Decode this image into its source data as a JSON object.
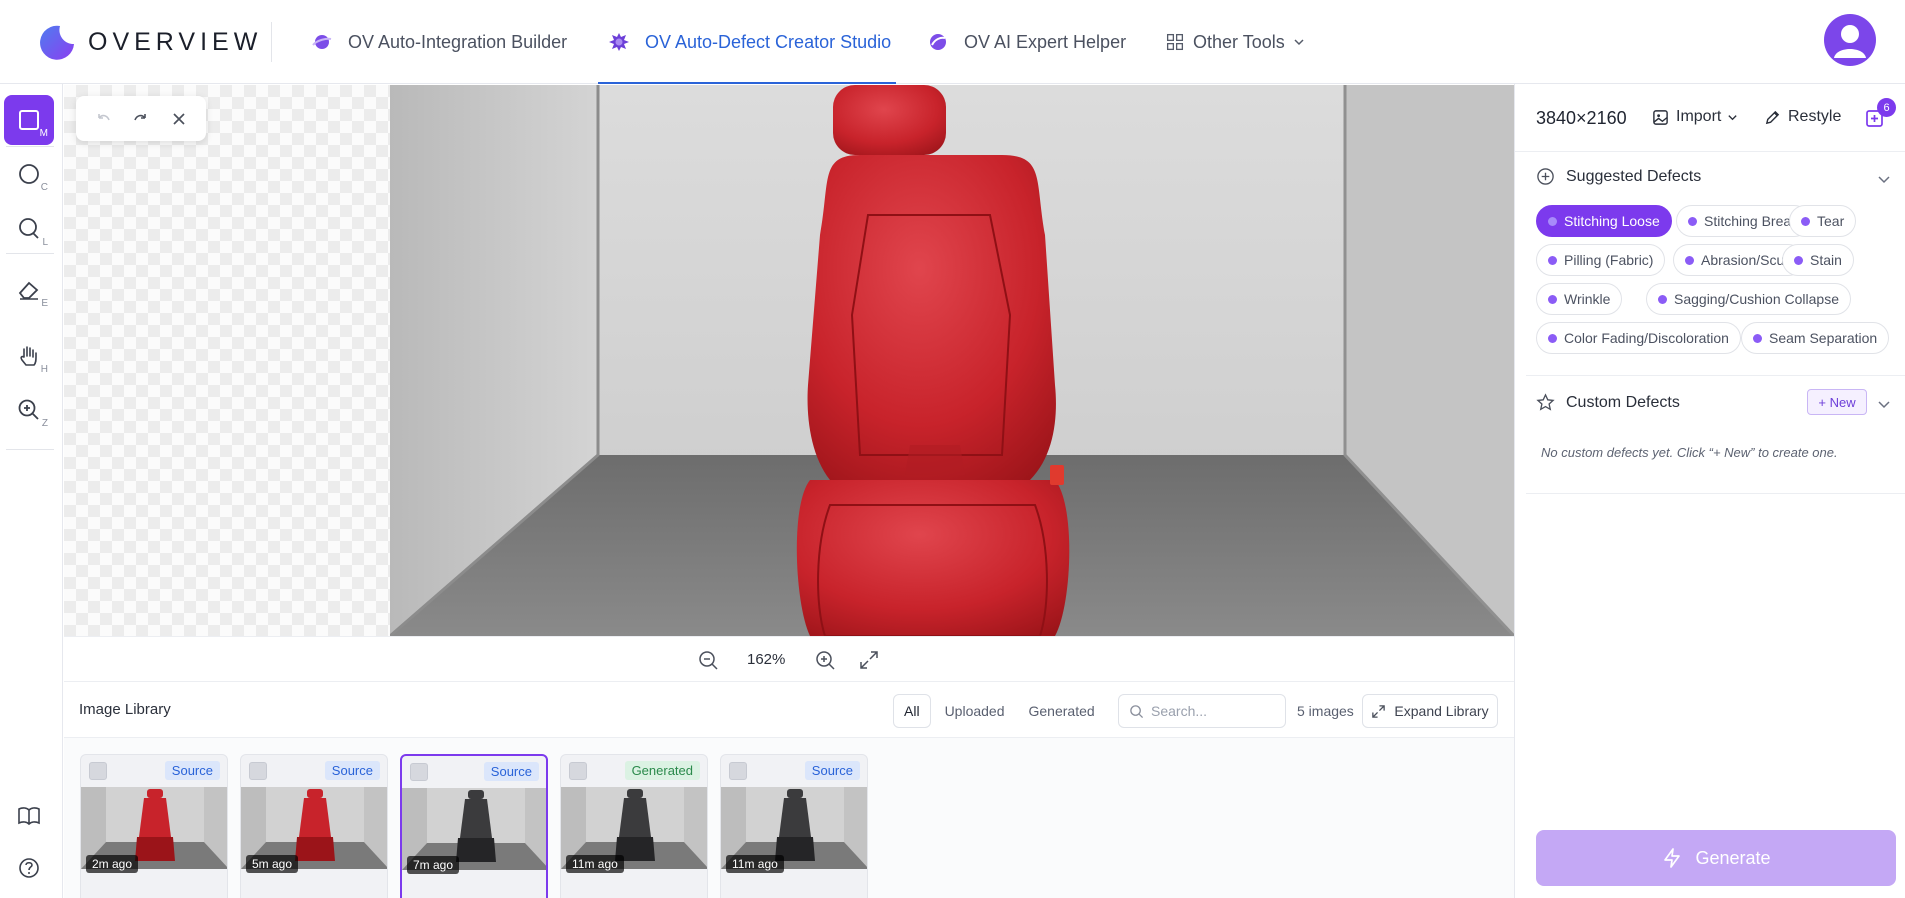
{
  "brand": {
    "name": "OVERVIEW",
    "accent": "#7c3aed",
    "link": "#2a63d8"
  },
  "nav": {
    "tabs": [
      {
        "label": "OV Auto-Integration Builder",
        "active": false
      },
      {
        "label": "OV Auto-Defect Creator Studio",
        "active": true
      },
      {
        "label": "OV AI Expert Helper",
        "active": false
      },
      {
        "label": "Other Tools",
        "active": false
      }
    ]
  },
  "tools": [
    {
      "icon": "rectangle-icon",
      "key": "M",
      "active": true
    },
    {
      "icon": "circle-icon",
      "key": "C",
      "active": false
    },
    {
      "icon": "lasso-icon",
      "key": "L",
      "active": false
    },
    {
      "icon": "eraser-icon",
      "key": "E",
      "active": false
    },
    {
      "icon": "hand-icon",
      "key": "H",
      "active": false
    },
    {
      "icon": "zoom-icon",
      "key": "Z",
      "active": false
    }
  ],
  "bottom_tools": [
    "book-icon",
    "help-icon"
  ],
  "canvas": {
    "zoom": "162%"
  },
  "library": {
    "title": "Image Library",
    "filters": [
      "All",
      "Uploaded",
      "Generated"
    ],
    "active_filter": "All",
    "search_placeholder": "Search...",
    "count": "5 images",
    "expand_label": "Expand Library",
    "images": [
      {
        "tag": "Source",
        "age": "2m ago",
        "seat": "red",
        "selected": false
      },
      {
        "tag": "Source",
        "age": "5m ago",
        "seat": "red",
        "selected": false
      },
      {
        "tag": "Source",
        "age": "7m ago",
        "seat": "dark",
        "selected": true
      },
      {
        "tag": "Generated",
        "age": "11m ago",
        "seat": "dark",
        "selected": false
      },
      {
        "tag": "Source",
        "age": "11m ago",
        "seat": "dark",
        "selected": false
      }
    ]
  },
  "panel": {
    "resolution": "3840×2160",
    "import_label": "Import",
    "restyle_label": "Restyle",
    "queue_count": "6",
    "suggested_title": "Suggested Defects",
    "suggested": [
      {
        "label": "Stitching Loose",
        "active": true
      },
      {
        "label": "Stitching Break",
        "active": false
      },
      {
        "label": "Tear",
        "active": false
      },
      {
        "label": "Pilling (Fabric)",
        "active": false
      },
      {
        "label": "Abrasion/Scuff",
        "active": false
      },
      {
        "label": "Stain",
        "active": false
      },
      {
        "label": "Wrinkle",
        "active": false
      },
      {
        "label": "Sagging/Cushion Collapse",
        "active": false
      },
      {
        "label": "Color Fading/Discoloration",
        "active": false
      },
      {
        "label": "Seam Separation",
        "active": false
      }
    ],
    "custom_title": "Custom Defects",
    "new_label": "+ New",
    "custom_empty": "No custom defects yet. Click “+ New” to create one.",
    "generate_label": "Generate"
  }
}
